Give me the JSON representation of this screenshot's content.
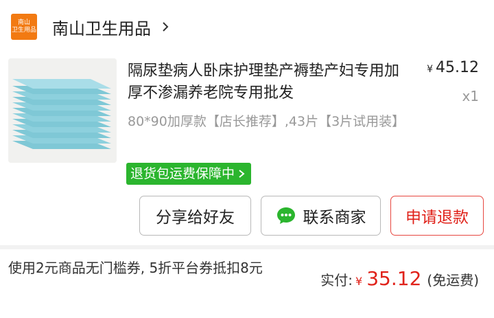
{
  "shop": {
    "logo_line1": "南山",
    "logo_line2": "卫生用品",
    "name": "南山卫生用品",
    "chevron_icon": "chevron-right-icon"
  },
  "product": {
    "title": "隔尿垫病人卧床护理垫产褥垫产妇专用加厚不渗漏养老院专用批发",
    "currency": "¥",
    "price": "45.12",
    "quantity": "x1",
    "sku": "80*90加厚款【店长推荐】,43片【3片试用装】",
    "return_badge": "退货包运费保障中"
  },
  "actions": {
    "share_label": "分享给好友",
    "contact_label": "联系商家",
    "refund_label": "申请退款"
  },
  "footer": {
    "coupon_text": "使用2元商品无门槛券, 5折平台券抵扣8元",
    "paid_label": "实付:",
    "currency": "¥",
    "paid_amount": "35.12",
    "shipping_note": "(免运费)"
  },
  "colors": {
    "accent_red": "#e0221a",
    "badge_green": "#2bb52e",
    "logo_orange": "#f27a12"
  }
}
